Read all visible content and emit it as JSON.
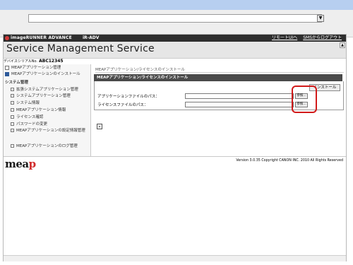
{
  "app": {
    "brand": "imageRUNNER ADVANCE",
    "model": "iR-ADV",
    "header_links": [
      "リモートUIへ",
      "SMSからログアウト"
    ],
    "title": "Service Management Service",
    "serial_label": "デバイスシリアルNo.",
    "serial_value": "ABC12345"
  },
  "sidebar": {
    "items": [
      {
        "label": "MEAPアプリケーション管理",
        "selected": false
      },
      {
        "label": "MEAPアプリケーションのインストール",
        "selected": true
      }
    ],
    "section": "システム管理",
    "subitems": [
      "拡張システムアプリケーション管理",
      "システムアプリケーション管理",
      "システム情報",
      "MEAPアプリケーション情報",
      "ライセンス確認",
      "パスワードの変更",
      "MEAPアプリケーションの設定情報管理",
      "MEAPアプリケーションのログ管理"
    ]
  },
  "main": {
    "breadcrumb": "MEAPアプリケーション/ライセンスのインストール",
    "panel_title": "MEAPアプリケーション/ライセンスのインストール",
    "install_label": "インストール",
    "rows": [
      {
        "label": "アプリケーションファイルのパス：",
        "value": "",
        "browse_label": "参照..."
      },
      {
        "label": "ライセンスファイルのパス：",
        "value": "",
        "browse_label": "参照..."
      }
    ]
  },
  "footer": {
    "logo": "meap",
    "version": "Version 3.0.35 Copyright CANON INC. 2010 All Rights Reserved"
  },
  "colors": {
    "header_bg": "#2e2e2e",
    "highlight": "#d11a1a",
    "browser_top": "#b7cff0"
  }
}
